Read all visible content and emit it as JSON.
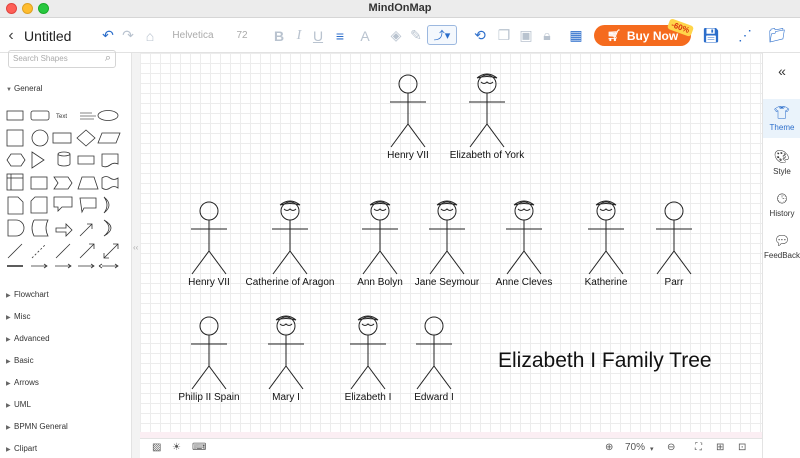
{
  "window": {
    "app_title": "MindOnMap"
  },
  "toolbar": {
    "doc_title": "Untitled",
    "font_name": "Helvetica",
    "font_size": "72",
    "buy_label": "Buy Now",
    "discount": "-60%"
  },
  "sidebar": {
    "search_placeholder": "Search Shapes",
    "general_label": "General",
    "text_sample": "Text",
    "categories": [
      "Flowchart",
      "Misc",
      "Advanced",
      "Basic",
      "Arrows",
      "UML",
      "BPMN General",
      "Clipart"
    ]
  },
  "canvas": {
    "title": "Elizabeth I Family Tree",
    "people": [
      {
        "name": "Henry VII",
        "crown": false
      },
      {
        "name": "Elizabeth of York",
        "crown": true
      },
      {
        "name": "Henry VII",
        "crown": false
      },
      {
        "name": "Catherine of Aragon",
        "crown": true
      },
      {
        "name": "Ann Bolyn",
        "crown": true
      },
      {
        "name": "Jane Seymour",
        "crown": true
      },
      {
        "name": "Anne Cleves",
        "crown": true
      },
      {
        "name": "Katherine",
        "crown": true
      },
      {
        "name": "Parr",
        "crown": false
      },
      {
        "name": "Philip II Spain",
        "crown": false
      },
      {
        "name": "Mary I",
        "crown": true
      },
      {
        "name": "Elizabeth I",
        "crown": true
      },
      {
        "name": "Edward I",
        "crown": false
      }
    ]
  },
  "right_panel": {
    "items": [
      {
        "label": "Theme",
        "icon": "shirt-icon",
        "active": true
      },
      {
        "label": "Style",
        "icon": "palette-icon",
        "active": false
      },
      {
        "label": "History",
        "icon": "clock-icon",
        "active": false
      },
      {
        "label": "FeedBack",
        "icon": "chat-icon",
        "active": false
      }
    ]
  },
  "status": {
    "zoom": "70%"
  }
}
